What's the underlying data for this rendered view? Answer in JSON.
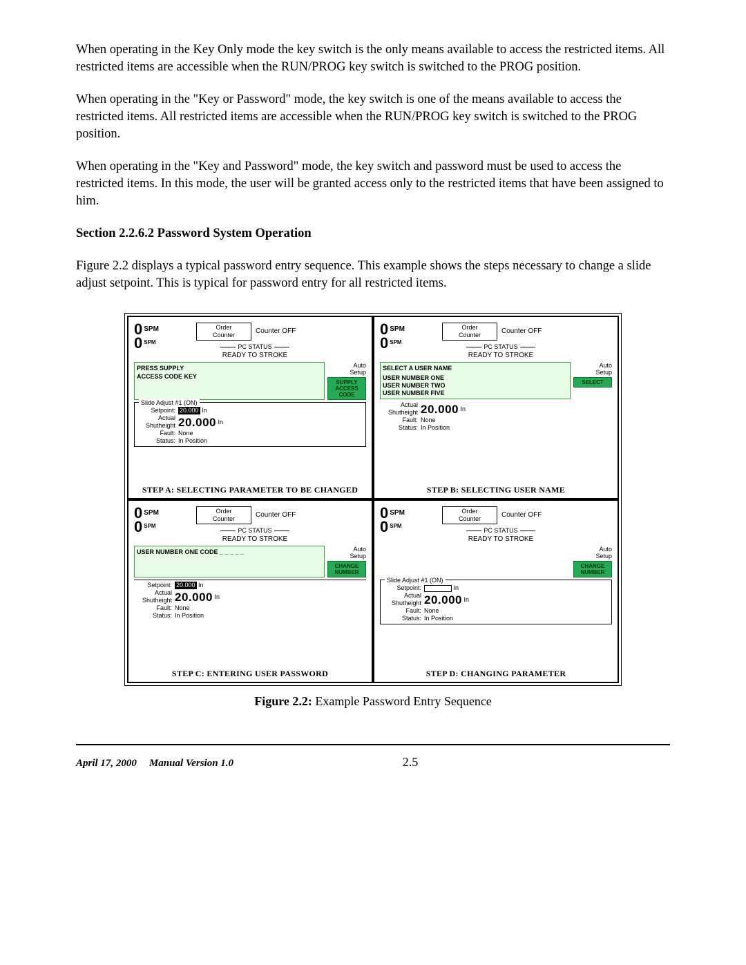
{
  "paragraphs": {
    "p1": "When operating in the Key Only mode the key switch is the only means available to access the restricted items.  All restricted items are accessible when the RUN/PROG key switch is switched to the PROG position.",
    "p2": "When operating in the \"Key or Password\" mode, the key switch is one of the means available to access the restricted items.  All restricted items are accessible when the RUN/PROG key switch is switched to the PROG position.",
    "p3": "When operating in the \"Key and Password\" mode, the key switch and password must be used to access the restricted items.  In this mode, the user will be granted access only to the restricted items that have been assigned to him."
  },
  "section_heading": "Section 2.2.6.2  Password System Operation",
  "p4": "Figure 2.2 displays a typical password entry sequence.  This example shows the steps necessary to change a slide adjust setpoint.  This is typical for password entry for all restricted items.",
  "common": {
    "spm_top_value": "0",
    "spm_label": "SPM",
    "order_top": "Order",
    "order_bot": "Counter",
    "counter_off": "Counter OFF",
    "pc_status": "PC STATUS",
    "ready": "READY TO STROKE",
    "auto": "Auto",
    "setup": "Setup",
    "slide_legend": "Slide Adjust #1 (ON)",
    "setpoint_k": "Setpoint:",
    "actual_k": "Actual",
    "shutheight_k": "Shutheight",
    "fault_k": "Fault:",
    "status_k": "Status:",
    "fault_v": "None",
    "status_v": "In Position",
    "shutheight_v": "20.000",
    "unit": "In"
  },
  "panels": {
    "a": {
      "prompt_l1": "PRESS SUPPLY",
      "prompt_l2": "ACCESS CODE KEY",
      "btn_l1": "SUPPLY",
      "btn_l2": "ACCESS",
      "btn_l3": "CODE",
      "setpoint_v": "20.000",
      "caption": "STEP A: SELECTING PARAMETER TO BE CHANGED"
    },
    "b": {
      "prompt": "SELECT A USER NAME",
      "users": [
        "USER NUMBER ONE",
        "USER NUMBER TWO",
        "USER NUMBER FIVE"
      ],
      "btn": "SELECT",
      "shutheight_v": "20.000",
      "caption": "STEP B: SELECTING USER NAME"
    },
    "c": {
      "prompt": "USER NUMBER ONE CODE _ _ _ _ _",
      "btn_l1": "CHANGE",
      "btn_l2": "NUMBER",
      "setpoint_v": "20.000",
      "shutheight_v": "20.000",
      "caption": "STEP C: ENTERING USER PASSWORD"
    },
    "d": {
      "btn_l1": "CHANGE",
      "btn_l2": "NUMBER",
      "shutheight_v": "20.000",
      "caption": "STEP D: CHANGING PARAMETER"
    }
  },
  "figure_caption_label": "Figure 2.2:",
  "figure_caption_text": " Example Password Entry Sequence",
  "footer": {
    "date": "April 17, 2000",
    "manual": "Manual Version 1.0",
    "page": "2.5"
  }
}
